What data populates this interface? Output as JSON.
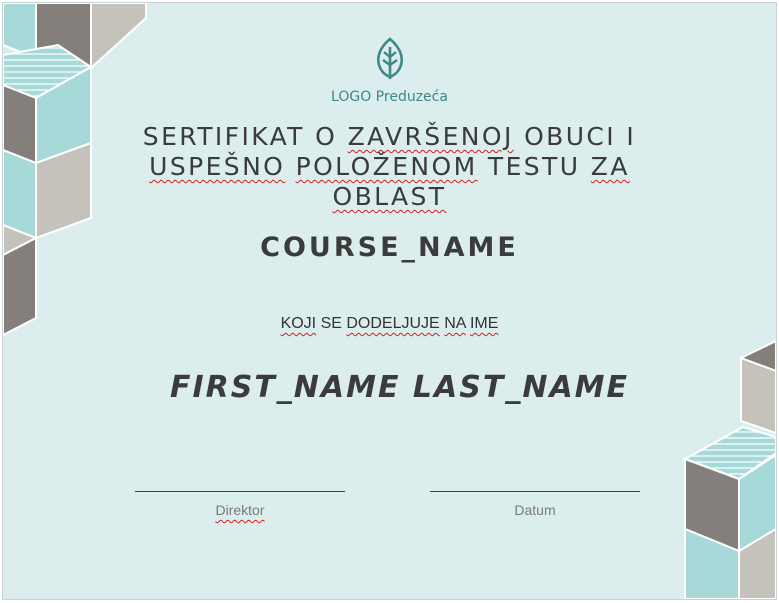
{
  "colors": {
    "background": "#dbeeed",
    "accent": "#3f8788",
    "text": "#3b3b3b",
    "tile_gray": "#857f7c",
    "tile_beige": "#c5c2bc",
    "tile_teal": "#a6d9d8"
  },
  "logo": {
    "icon": "leaf-icon",
    "text": "LOGO Preduzeća"
  },
  "title": {
    "words": [
      "SERTIFIKAT",
      "O",
      "ZAVRŠENOJ",
      "OBUCI",
      "I",
      "USPEŠNO",
      "POLOŽENOM",
      "TESTU",
      "ZA",
      "OBLAST"
    ]
  },
  "course_name": "COURSE_NAME",
  "awarded": {
    "words": [
      "KOJI",
      "SE",
      "DODELJUJE",
      "NA",
      "IME"
    ]
  },
  "recipient_name": "FIRST_NAME LAST_NAME",
  "signatures": {
    "director_label": "Direktor",
    "date_label": "Datum"
  }
}
